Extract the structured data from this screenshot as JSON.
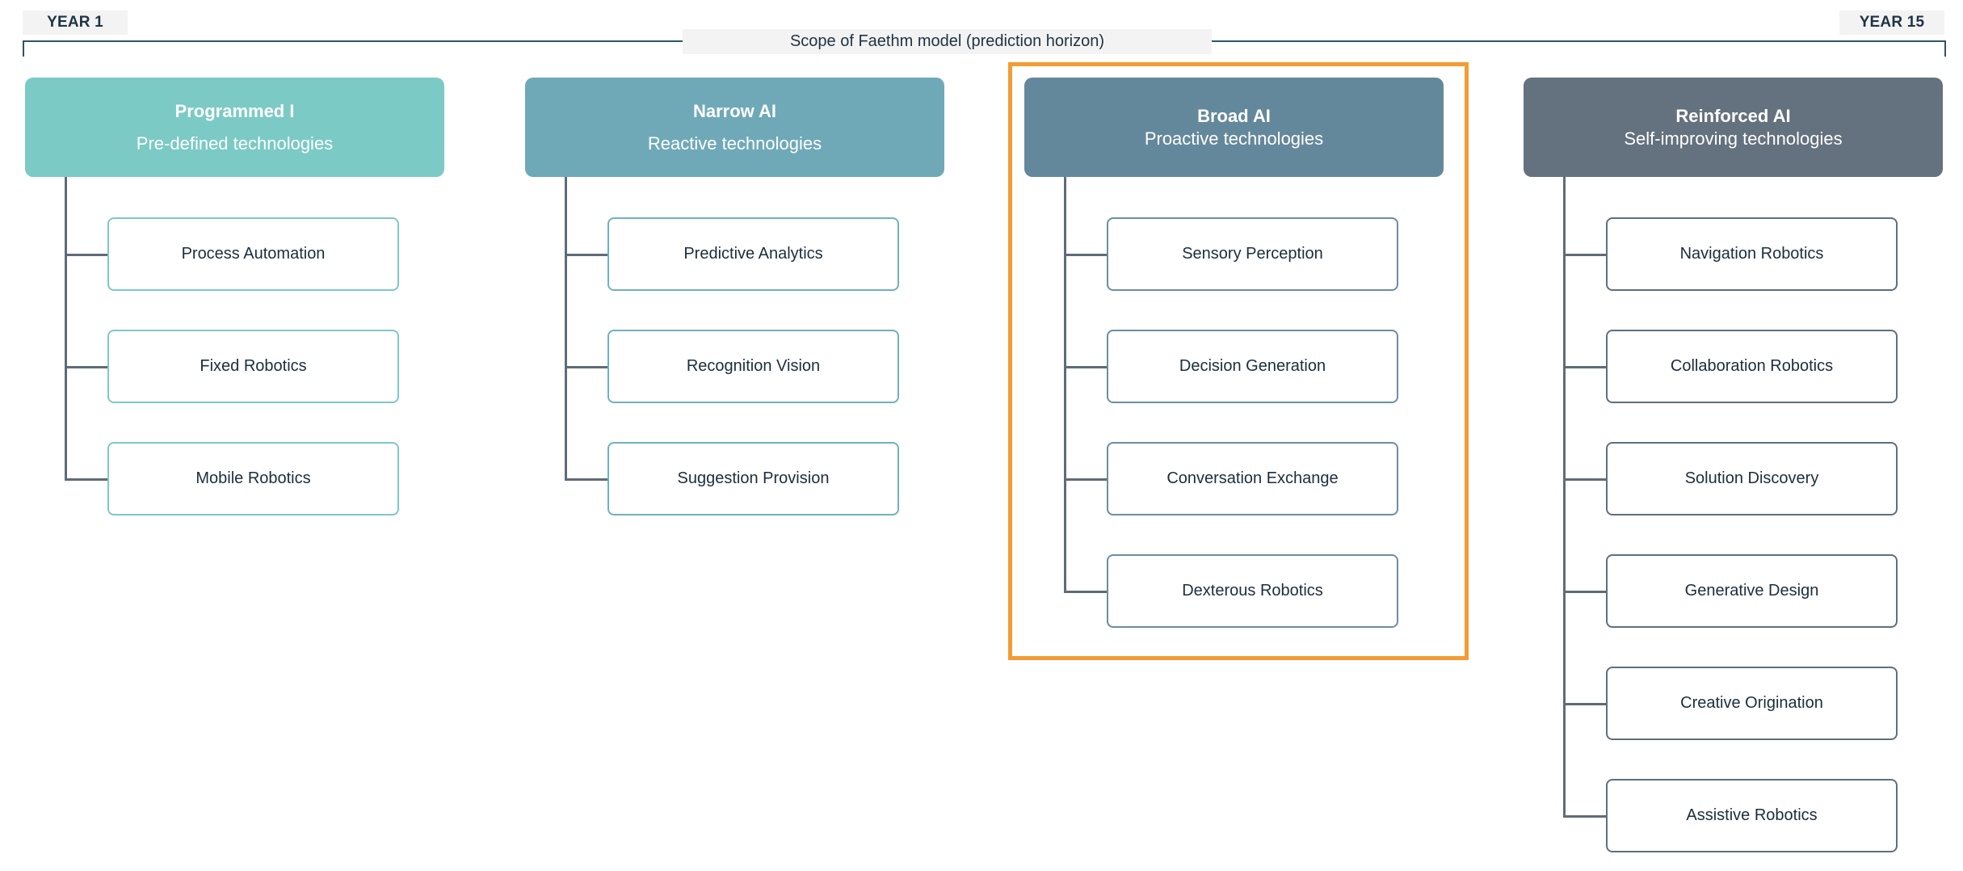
{
  "timeline": {
    "start_label": "YEAR 1",
    "end_label": "YEAR 15",
    "scope_label": "Scope of Faethm model (prediction horizon)",
    "bracket_color": "#2e5566"
  },
  "highlight": {
    "column_index": 2,
    "color": "#f39c33"
  },
  "connector_color": "#5f6b78",
  "columns": [
    {
      "title": "Programmed I",
      "subtitle": "Pre-defined technologies",
      "header_color": "#7bcac6",
      "border_color": "#7ec8c8",
      "spacing": "loose",
      "items": [
        "Process Automation",
        "Fixed Robotics",
        "Mobile Robotics"
      ]
    },
    {
      "title": "Narrow AI",
      "subtitle": "Reactive technologies",
      "header_color": "#6fa9b8",
      "border_color": "#6fb1bd",
      "spacing": "loose",
      "items": [
        "Predictive Analytics",
        "Recognition Vision",
        "Suggestion Provision"
      ]
    },
    {
      "title": "Broad AI",
      "subtitle": "Proactive technologies",
      "header_color": "#64889b",
      "border_color": "#6a8ea3",
      "spacing": "tight",
      "items": [
        "Sensory Perception",
        "Decision Generation",
        "Conversation Exchange",
        "Dexterous Robotics"
      ]
    },
    {
      "title": "Reinforced AI",
      "subtitle": "Self-improving technologies",
      "header_color": "#64717e",
      "border_color": "#5f6f7d",
      "spacing": "tight",
      "items": [
        "Navigation Robotics",
        "Collaboration Robotics",
        "Solution Discovery",
        "Generative Design",
        "Creative Origination",
        "Assistive Robotics"
      ]
    }
  ]
}
